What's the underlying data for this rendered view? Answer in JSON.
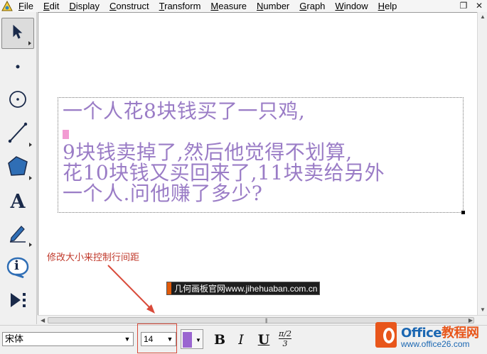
{
  "menubar": {
    "app_icon": "sketchpad-app-icon",
    "items": [
      {
        "pre": "",
        "u": "F",
        "post": "ile"
      },
      {
        "pre": "",
        "u": "E",
        "post": "dit"
      },
      {
        "pre": "",
        "u": "D",
        "post": "isplay"
      },
      {
        "pre": "",
        "u": "C",
        "post": "onstruct"
      },
      {
        "pre": "",
        "u": "T",
        "post": "ransform"
      },
      {
        "pre": "",
        "u": "M",
        "post": "easure"
      },
      {
        "pre": "",
        "u": "N",
        "post": "umber"
      },
      {
        "pre": "",
        "u": "G",
        "post": "raph"
      },
      {
        "pre": "",
        "u": "W",
        "post": "indow"
      },
      {
        "pre": "",
        "u": "H",
        "post": "elp"
      }
    ],
    "window_controls": {
      "restore": "❐",
      "close": "✕"
    }
  },
  "toolbox": {
    "tools": [
      {
        "name": "arrow-select-tool",
        "icon": "pointer-arrow-icon",
        "active": true
      },
      {
        "name": "point-tool",
        "icon": "point-icon"
      },
      {
        "name": "compass-tool",
        "icon": "circle-icon"
      },
      {
        "name": "straightedge-tool",
        "icon": "line-segment-icon"
      },
      {
        "name": "polygon-tool",
        "icon": "polygon-icon"
      },
      {
        "name": "text-tool",
        "icon": "text-a-icon",
        "label": "A"
      },
      {
        "name": "marker-tool",
        "icon": "marker-pen-icon"
      },
      {
        "name": "information-tool",
        "icon": "info-bubble-icon",
        "label": "i"
      },
      {
        "name": "custom-tool",
        "icon": "custom-tools-icon"
      }
    ]
  },
  "canvas": {
    "text_lines": [
      "一个人花8块钱买了一只鸡,",
      "",
      "9块钱卖掉了,然后他觉得不划算,",
      "花10块钱又买回来了,11块卖给另外",
      "一个人.问他赚了多少?"
    ],
    "annotation": "修改大小来控制行间距",
    "site_watermark": "几何画板官网www.jihehuaban.com.cn"
  },
  "formatbar": {
    "font_name": "宋体",
    "font_size": "14",
    "text_color": "#9a65d0",
    "bold_label": "B",
    "italic_label": "I",
    "underline_label": "U",
    "fraction_top": "π/2",
    "fraction_bottom": "3"
  },
  "logo": {
    "brand_main": "Office",
    "brand_suffix": "教程网",
    "url": "www.office26.com"
  },
  "colors": {
    "text_purple": "#9a7cc6",
    "annotation_red": "#c0392b",
    "caret_pink": "#f29ad2",
    "brand_orange": "#e8561b",
    "brand_blue": "#1b67b2"
  }
}
